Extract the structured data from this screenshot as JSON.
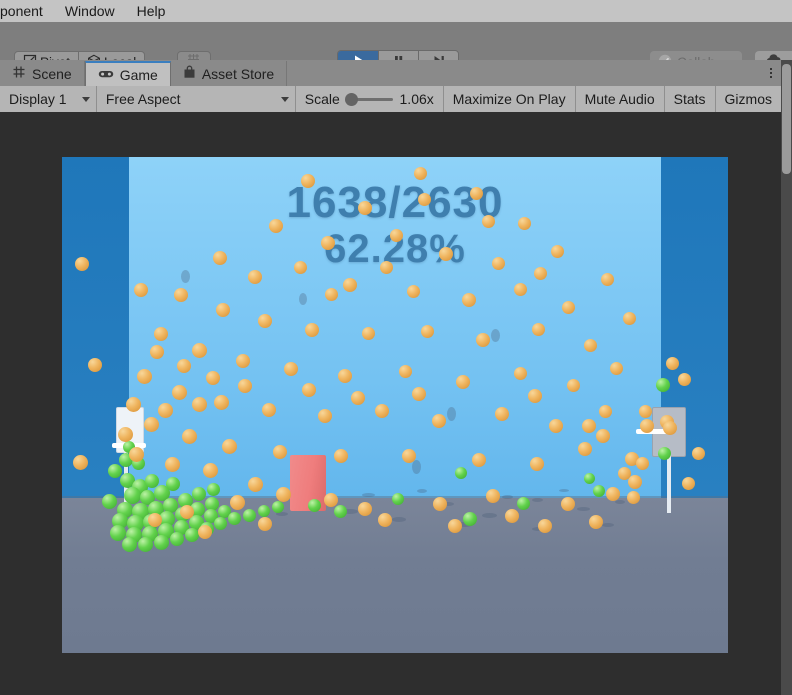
{
  "menubar": {
    "items": [
      {
        "label": "ponent",
        "name": "menu-component"
      },
      {
        "label": "Window",
        "name": "menu-window"
      },
      {
        "label": "Help",
        "name": "menu-help"
      }
    ]
  },
  "toolbar": {
    "pivot_label": "Pivot",
    "pivot_icon": "pivot-icon",
    "local_label": "Local",
    "local_icon": "local-axis-icon",
    "grid_snap_icon": "grid-snapping-icon",
    "play_icon": "play-icon",
    "pause_icon": "pause-icon",
    "step_icon": "step-icon",
    "play_active": true,
    "collab_label": "Collab",
    "collab_icon": "check-circle-icon",
    "collab_caret": "chevron-down-icon",
    "cloud_icon": "cloud-icon",
    "accent_color": "#3a6a9e"
  },
  "tabs": [
    {
      "label": "Scene",
      "icon": "grid-icon",
      "active": false,
      "name": "tab-scene"
    },
    {
      "label": "Game",
      "icon": "gamepad-icon",
      "active": true,
      "name": "tab-game"
    },
    {
      "label": "Asset Store",
      "icon": "store-bag-icon",
      "active": false,
      "name": "tab-asset-store"
    }
  ],
  "tab_menu_icon": "more-vertical-icon",
  "game_toolbar": {
    "display_value": "Display 1",
    "aspect_value": "Free Aspect",
    "scale_label": "Scale",
    "scale_value": "1.06x",
    "maximize_label": "Maximize On Play",
    "mute_label": "Mute Audio",
    "stats_label": "Stats",
    "gizmos_label": "Gizmos"
  },
  "game_view": {
    "score_made_total": "1638/2630",
    "score_percent": "62.28%",
    "score_color": "#3f7fae",
    "sky_color": "#8ed2f8",
    "side_wall_color": "#2079bc",
    "floor_color": "#737f94",
    "ball_orange_color": "#efb45e",
    "ball_green_color": "#62d24c",
    "box_color": "#ef7d7d",
    "hoop_left_name": "basketball-hoop-left",
    "hoop_right_name": "basketball-hoop-right",
    "box_name": "pink-obstacle-box"
  }
}
